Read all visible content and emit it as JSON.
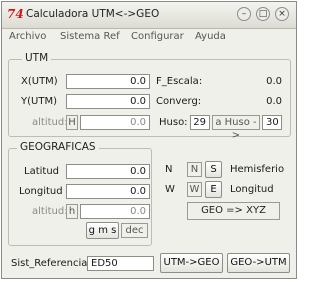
{
  "window": {
    "title": "Calculadora UTM<->GEO",
    "app_icon": "74"
  },
  "titlebar_buttons": {
    "minimize": "–",
    "maximize": "□",
    "close": "×"
  },
  "menu": [
    "Archivo",
    "Sistema Ref",
    "Configurar",
    "Ayuda"
  ],
  "utm": {
    "title": "UTM",
    "x_label": "X(UTM)",
    "x_value": "0.0",
    "y_label": "Y(UTM)",
    "y_value": "0.0",
    "alt_label": "altitud:",
    "alt_unit": "H",
    "alt_value": "0.0",
    "escala_label": "F_Escala:",
    "escala_value": "0.0",
    "converg_label": "Converg:",
    "converg_value": "0.0",
    "huso_label": "Huso:",
    "huso_value": "29",
    "a_huso_label": "a Huso ->",
    "huso_target": "30"
  },
  "geo": {
    "title": "GEOGRAFICAS",
    "lat_label": "Latitud",
    "lat_value": "0.0",
    "lon_label": "Longitud",
    "lon_value": "0.0",
    "alt_label": "altitud:",
    "alt_unit": "h",
    "alt_value": "0.0",
    "gms_label": "g m s",
    "dec_label": "dec"
  },
  "hemisphere": {
    "n_label": "N",
    "n_button": "N",
    "s_button": "S",
    "hemisferio_label": "Hemisferio",
    "w_label": "W",
    "w_button": "W",
    "e_button": "E",
    "longitud_label": "Longitud",
    "geo_xyz_label": "GEO => XYZ"
  },
  "footer": {
    "sist_label": "Sist_Referencia:",
    "sist_value": "ED50",
    "utm_geo_button": "UTM->GEO",
    "geo_utm_button": "GEO->UTM"
  }
}
